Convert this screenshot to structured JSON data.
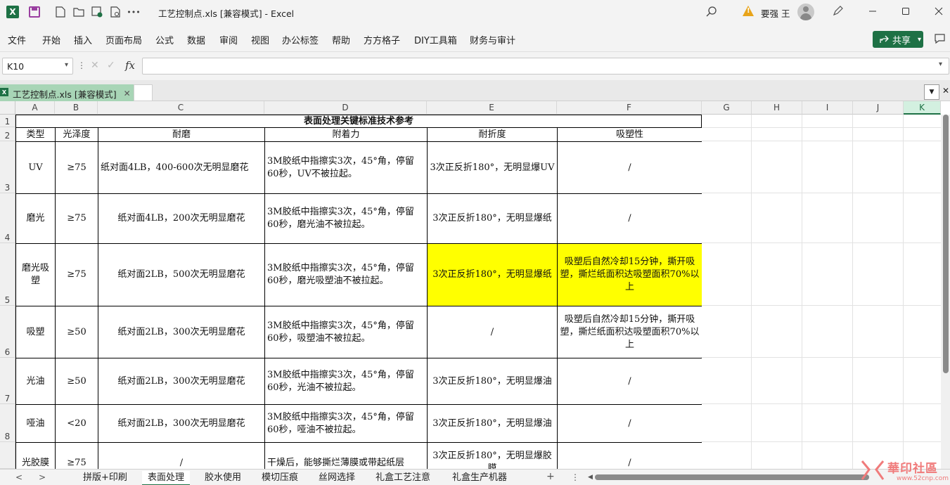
{
  "titlebar": {
    "doc_title": "工艺控制点.xls  [兼容模式]  -  Excel",
    "user_name": "要强 王",
    "more": "•••"
  },
  "menu": [
    "文件",
    "开始",
    "插入",
    "页面布局",
    "公式",
    "数据",
    "审阅",
    "视图",
    "办公标签",
    "帮助",
    "方方格子",
    "DIY工具箱",
    "财务与审计"
  ],
  "share_label": "共享",
  "formula_bar": {
    "name_box": "K10",
    "fx": "fx",
    "value": ""
  },
  "workbook_tab": {
    "label": "工艺控制点.xls  [兼容模式]"
  },
  "columns": [
    "A",
    "B",
    "C",
    "D",
    "E",
    "F",
    "G",
    "H",
    "I",
    "J",
    "K"
  ],
  "row_numbers": [
    "1",
    "2",
    "3",
    "4",
    "5",
    "6",
    "7",
    "8"
  ],
  "table": {
    "title": "表面处理关键标准技术参考",
    "headers": [
      "类型",
      "光泽度",
      "耐磨",
      "附着力",
      "耐折度",
      "吸塑性"
    ],
    "rows": [
      [
        "UV",
        "≥75",
        "纸对面4LB，400-600次无明显磨花",
        "3M胶纸中指擦实3次，45°角，停留60秒，UV不被拉起。",
        "3次正反折180°，无明显爆UV",
        "/"
      ],
      [
        "磨光",
        "≥75",
        "纸对面4LB，200次无明显磨花",
        "3M胶纸中指擦实3次，45°角，停留60秒，磨光油不被拉起。",
        "3次正反折180°，无明显爆纸",
        "/"
      ],
      [
        "磨光吸塑",
        "≥75",
        "纸对面2LB，500次无明显磨花",
        "3M胶纸中指擦实3次，45°角，停留60秒，磨光吸塑油不被拉起。",
        "3次正反折180°，无明显爆纸",
        "吸塑后自然冷却15分钟，撕开吸塑，撕烂纸面积达吸塑面积70%以上"
      ],
      [
        "吸塑",
        "≥50",
        "纸对面2LB，300次无明显磨花",
        "3M胶纸中指擦实3次，45°角，停留60秒，吸塑油不被拉起。",
        "/",
        "吸塑后自然冷却15分钟，撕开吸塑，撕烂纸面积达吸塑面积70%以上"
      ],
      [
        "光油",
        "≥50",
        "纸对面2LB，300次无明显磨花",
        "3M胶纸中指擦实3次，45°角，停留60秒，光油不被拉起。",
        "3次正反折180°，无明显爆油",
        "/"
      ],
      [
        "哑油",
        "<20",
        "纸对面2LB，300次无明显磨花",
        "3M胶纸中指擦实3次，45°角，停留60秒，哑油不被拉起。",
        "3次正反折180°，无明显爆油",
        "/"
      ],
      [
        "光胶膜",
        "≥75",
        "/",
        "干燥后，能够撕烂薄膜或带起纸层",
        "3次正反折180°，无明显爆胶膜",
        "/"
      ]
    ],
    "highlight_color": "#ffff00"
  },
  "sheets": [
    "拼版+印刷",
    "表面处理",
    "胶水使用",
    "模切压痕",
    "丝网选择",
    "礼盒工艺注意",
    "礼盒生产机器"
  ],
  "active_sheet": "表面处理",
  "watermark": {
    "text": "華印社區",
    "url": "www.52cnp.com"
  },
  "colors": {
    "excel_green": "#1e7145",
    "tab_green": "#a8d5b6",
    "warning": "#e8a41a"
  }
}
